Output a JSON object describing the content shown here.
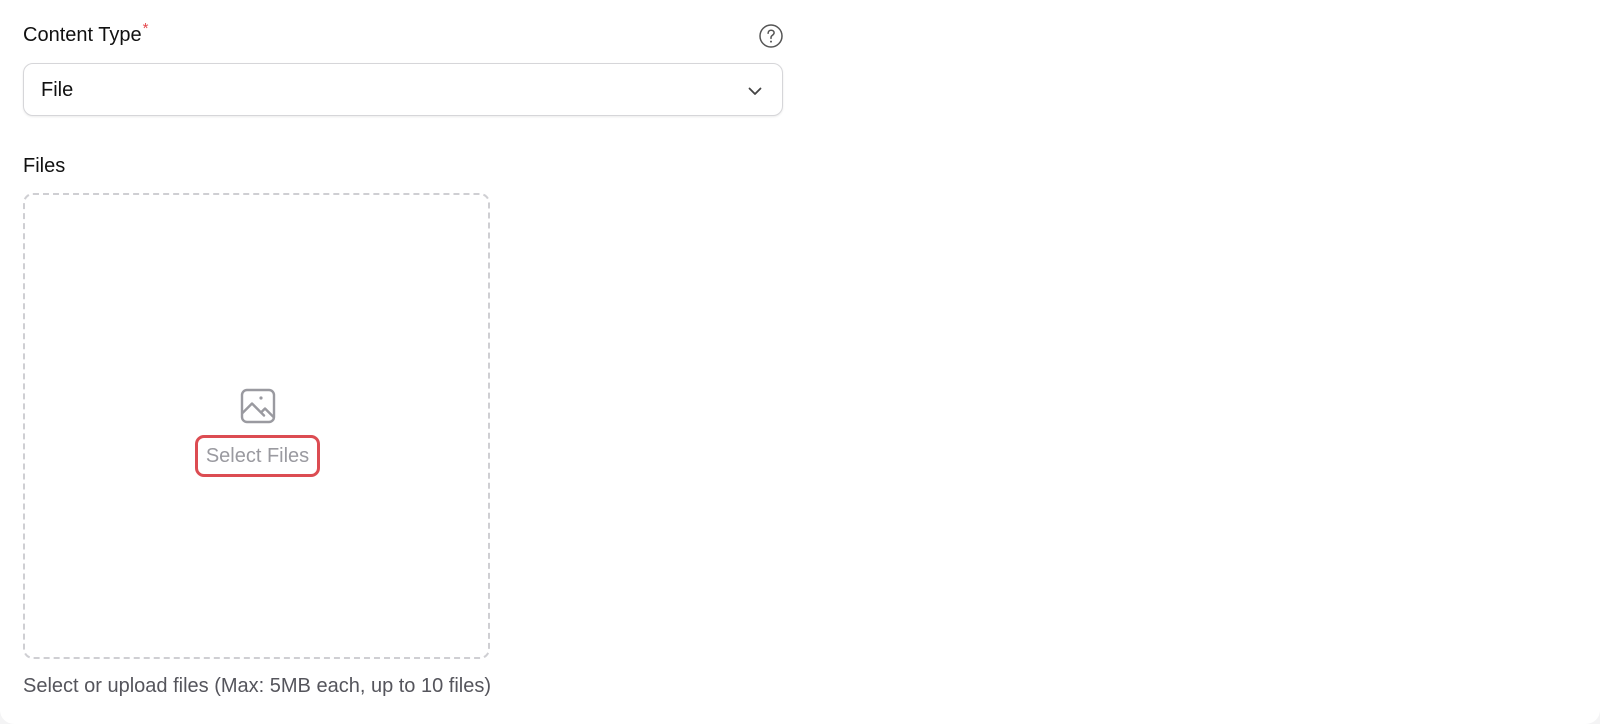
{
  "content_type": {
    "label": "Content Type",
    "required_marker": "*",
    "help_icon": "question-circle-icon",
    "selected_value": "File",
    "dropdown_icon": "chevron-down-icon"
  },
  "files": {
    "label": "Files",
    "upload_icon": "image-icon",
    "select_button_label": "Select Files",
    "helper_text": "Select or upload files (Max: 5MB each, up to 10 files)"
  },
  "colors": {
    "required": "#e5484d",
    "focus_border": "#dc4c52",
    "dashed_border": "#cfcfd3",
    "muted_text": "#9a9aa0"
  }
}
